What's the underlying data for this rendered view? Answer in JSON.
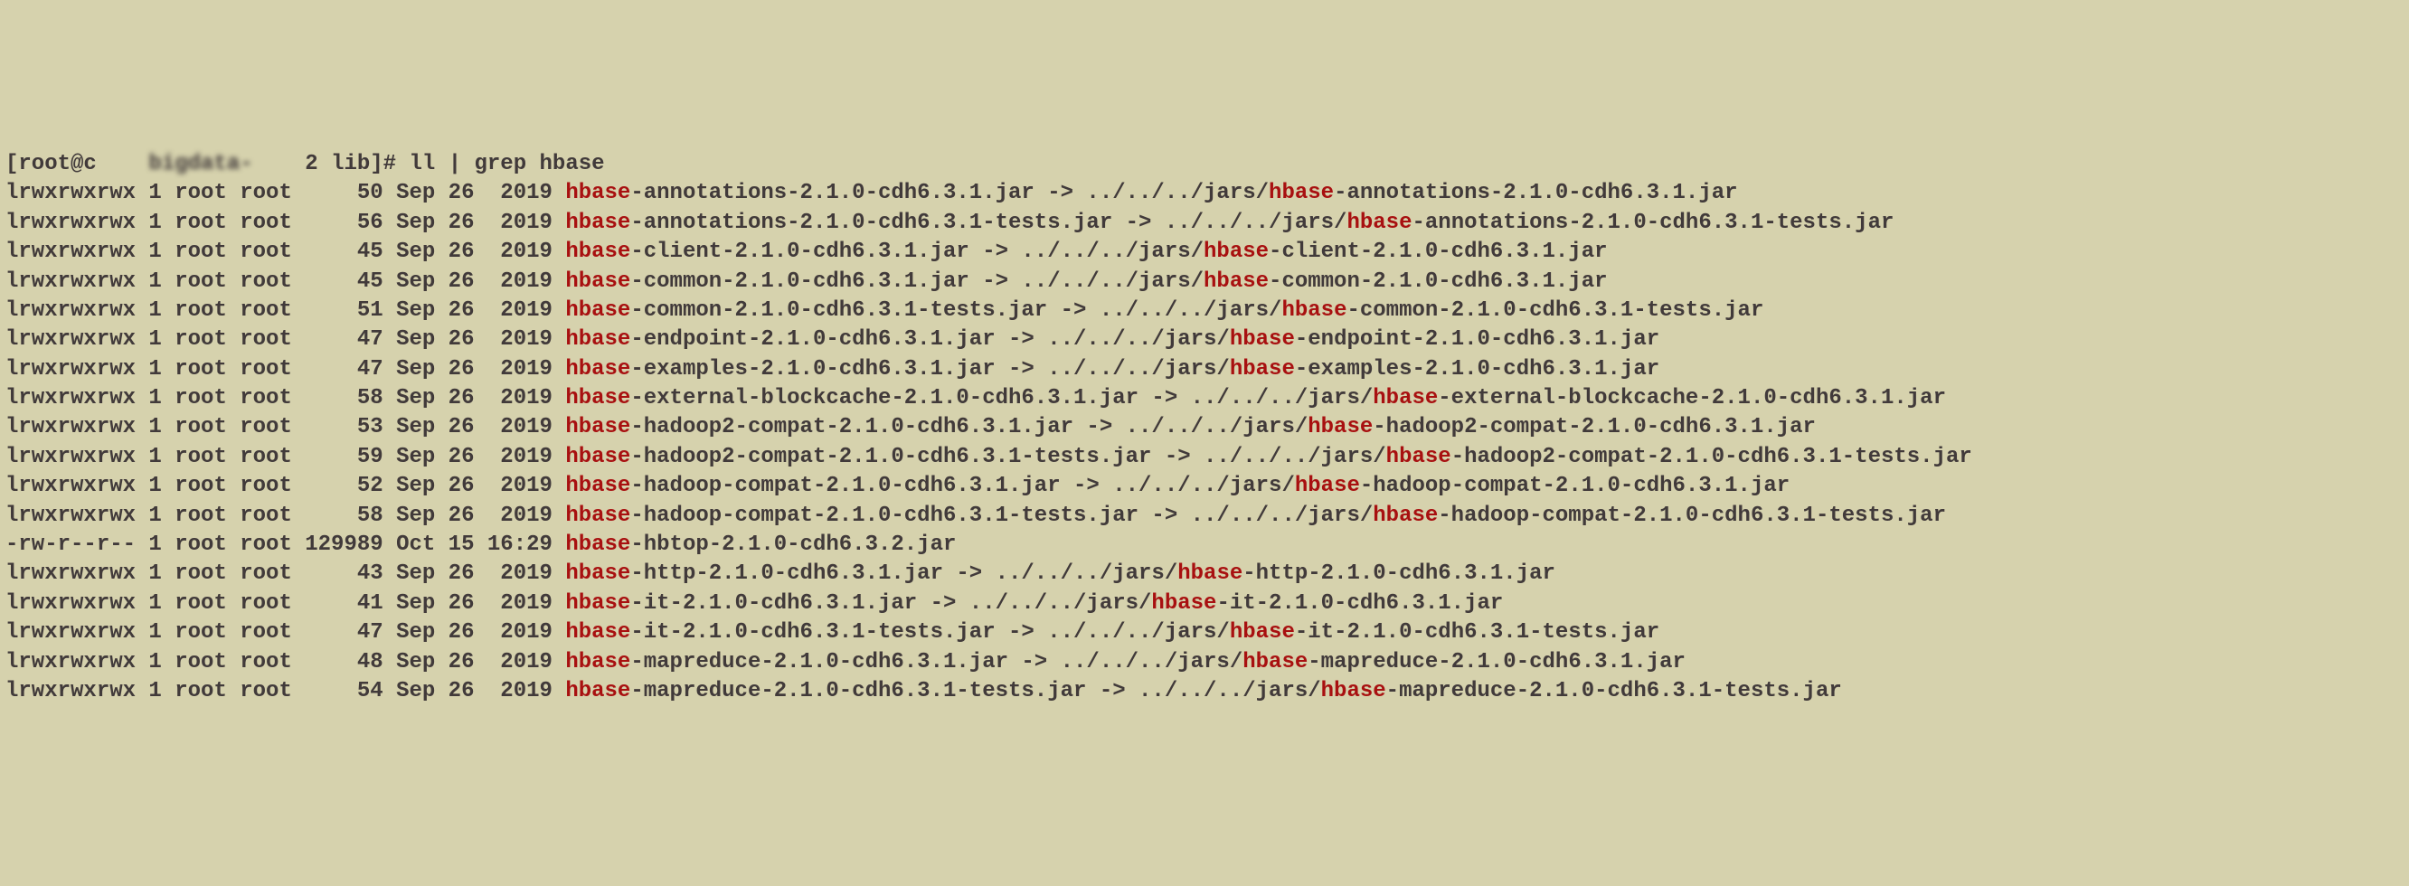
{
  "prompt": {
    "user": "[root@c",
    "host_blur": "    bigdata-    ",
    "suffix": "2 lib]# ll | grep hbase"
  },
  "rows": [
    {
      "perms": "lrwxrwxrwx 1 root root     50 Sep 26  2019 ",
      "hl1": "hbase",
      "mid1": "-annotations-2.1.0-cdh6.3.1.jar -> ../../../jars/",
      "hl2": "hbase",
      "mid2": "-annotations-2.1.0-cdh6.3.1.jar"
    },
    {
      "perms": "lrwxrwxrwx 1 root root     56 Sep 26  2019 ",
      "hl1": "hbase",
      "mid1": "-annotations-2.1.0-cdh6.3.1-tests.jar -> ../../../jars/",
      "hl2": "hbase",
      "mid2": "-annotations-2.1.0-cdh6.3.1-tests.jar"
    },
    {
      "perms": "lrwxrwxrwx 1 root root     45 Sep 26  2019 ",
      "hl1": "hbase",
      "mid1": "-client-2.1.0-cdh6.3.1.jar -> ../../../jars/",
      "hl2": "hbase",
      "mid2": "-client-2.1.0-cdh6.3.1.jar"
    },
    {
      "perms": "lrwxrwxrwx 1 root root     45 Sep 26  2019 ",
      "hl1": "hbase",
      "mid1": "-common-2.1.0-cdh6.3.1.jar -> ../../../jars/",
      "hl2": "hbase",
      "mid2": "-common-2.1.0-cdh6.3.1.jar"
    },
    {
      "perms": "lrwxrwxrwx 1 root root     51 Sep 26  2019 ",
      "hl1": "hbase",
      "mid1": "-common-2.1.0-cdh6.3.1-tests.jar -> ../../../jars/",
      "hl2": "hbase",
      "mid2": "-common-2.1.0-cdh6.3.1-tests.jar"
    },
    {
      "perms": "lrwxrwxrwx 1 root root     47 Sep 26  2019 ",
      "hl1": "hbase",
      "mid1": "-endpoint-2.1.0-cdh6.3.1.jar -> ../../../jars/",
      "hl2": "hbase",
      "mid2": "-endpoint-2.1.0-cdh6.3.1.jar"
    },
    {
      "perms": "lrwxrwxrwx 1 root root     47 Sep 26  2019 ",
      "hl1": "hbase",
      "mid1": "-examples-2.1.0-cdh6.3.1.jar -> ../../../jars/",
      "hl2": "hbase",
      "mid2": "-examples-2.1.0-cdh6.3.1.jar"
    },
    {
      "perms": "lrwxrwxrwx 1 root root     58 Sep 26  2019 ",
      "hl1": "hbase",
      "mid1": "-external-blockcache-2.1.0-cdh6.3.1.jar -> ../../../jars/",
      "hl2": "hbase",
      "mid2": "-external-blockcache-2.1.0-cdh6.3.1.jar"
    },
    {
      "perms": "lrwxrwxrwx 1 root root     53 Sep 26  2019 ",
      "hl1": "hbase",
      "mid1": "-hadoop2-compat-2.1.0-cdh6.3.1.jar -> ../../../jars/",
      "hl2": "hbase",
      "mid2": "-hadoop2-compat-2.1.0-cdh6.3.1.jar"
    },
    {
      "perms": "lrwxrwxrwx 1 root root     59 Sep 26  2019 ",
      "hl1": "hbase",
      "mid1": "-hadoop2-compat-2.1.0-cdh6.3.1-tests.jar -> ../../../jars/",
      "hl2": "hbase",
      "mid2": "-hadoop2-compat-2.1.0-cdh6.3.1-tests.jar"
    },
    {
      "perms": "lrwxrwxrwx 1 root root     52 Sep 26  2019 ",
      "hl1": "hbase",
      "mid1": "-hadoop-compat-2.1.0-cdh6.3.1.jar -> ../../../jars/",
      "hl2": "hbase",
      "mid2": "-hadoop-compat-2.1.0-cdh6.3.1.jar"
    },
    {
      "perms": "lrwxrwxrwx 1 root root     58 Sep 26  2019 ",
      "hl1": "hbase",
      "mid1": "-hadoop-compat-2.1.0-cdh6.3.1-tests.jar -> ../../../jars/",
      "hl2": "hbase",
      "mid2": "-hadoop-compat-2.1.0-cdh6.3.1-tests.jar"
    },
    {
      "perms": "-rw-r--r-- 1 root root 129989 Oct 15 16:29 ",
      "hl1": "hbase",
      "mid1": "-hbtop-2.1.0-cdh6.3.2.jar",
      "hl2": "",
      "mid2": ""
    },
    {
      "perms": "lrwxrwxrwx 1 root root     43 Sep 26  2019 ",
      "hl1": "hbase",
      "mid1": "-http-2.1.0-cdh6.3.1.jar -> ../../../jars/",
      "hl2": "hbase",
      "mid2": "-http-2.1.0-cdh6.3.1.jar"
    },
    {
      "perms": "lrwxrwxrwx 1 root root     41 Sep 26  2019 ",
      "hl1": "hbase",
      "mid1": "-it-2.1.0-cdh6.3.1.jar -> ../../../jars/",
      "hl2": "hbase",
      "mid2": "-it-2.1.0-cdh6.3.1.jar"
    },
    {
      "perms": "lrwxrwxrwx 1 root root     47 Sep 26  2019 ",
      "hl1": "hbase",
      "mid1": "-it-2.1.0-cdh6.3.1-tests.jar -> ../../../jars/",
      "hl2": "hbase",
      "mid2": "-it-2.1.0-cdh6.3.1-tests.jar"
    },
    {
      "perms": "lrwxrwxrwx 1 root root     48 Sep 26  2019 ",
      "hl1": "hbase",
      "mid1": "-mapreduce-2.1.0-cdh6.3.1.jar -> ../../../jars/",
      "hl2": "hbase",
      "mid2": "-mapreduce-2.1.0-cdh6.3.1.jar"
    },
    {
      "perms": "lrwxrwxrwx 1 root root     54 Sep 26  2019 ",
      "hl1": "hbase",
      "mid1": "-mapreduce-2.1.0-cdh6.3.1-tests.jar -> ../../../jars/",
      "hl2": "hbase",
      "mid2": "-mapreduce-2.1.0-cdh6.3.1-tests.jar"
    }
  ]
}
